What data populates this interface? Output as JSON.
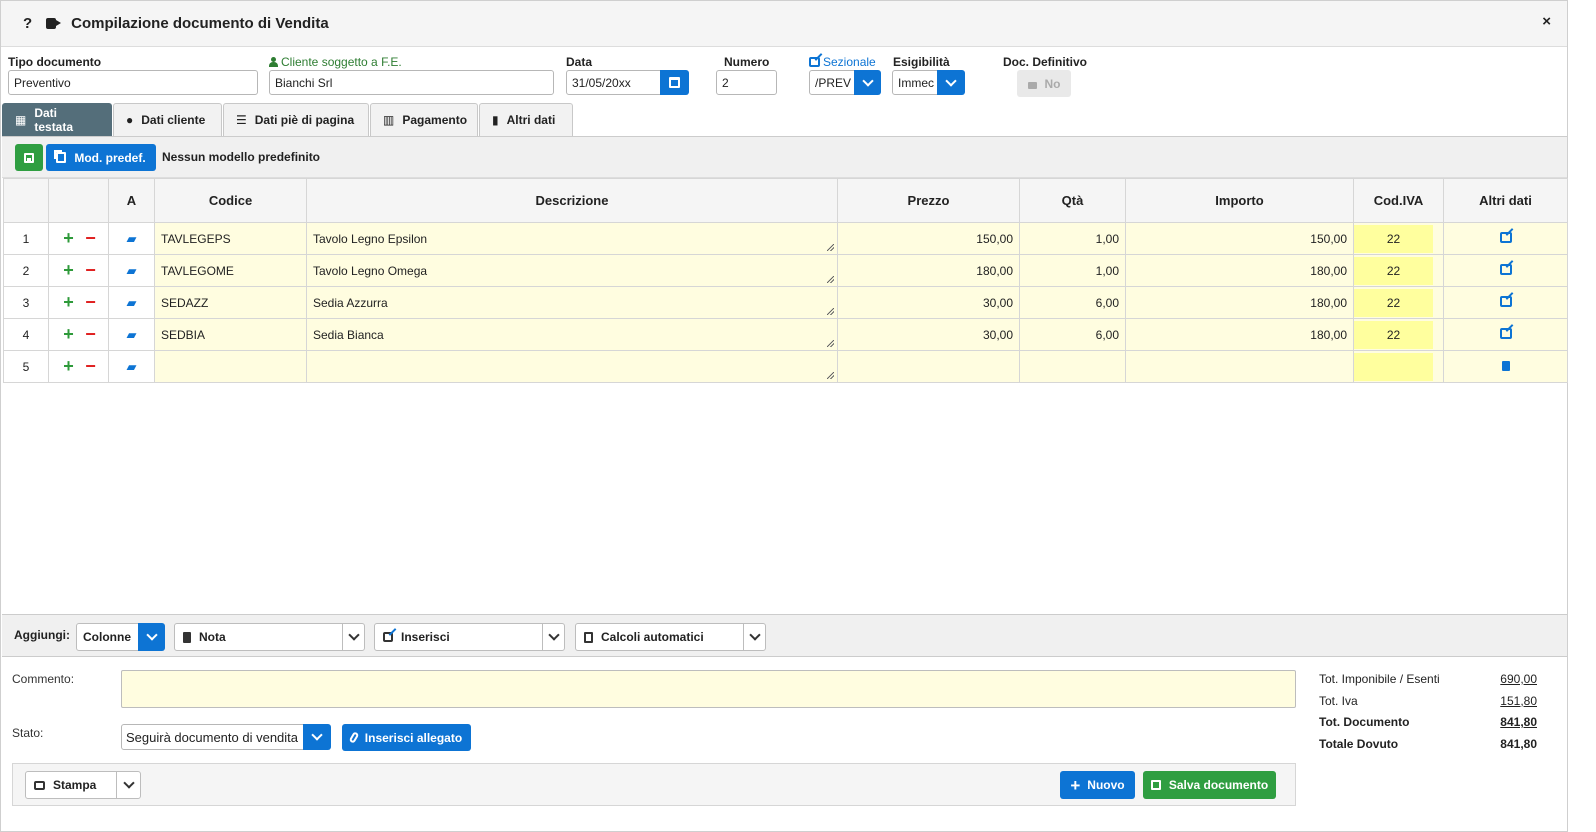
{
  "title": {
    "help": "?",
    "text": "Compilazione documento di Vendita",
    "close": "×"
  },
  "header": {
    "tipo_label": "Tipo documento",
    "tipo_value": "Preventivo",
    "cliente_label": "Cliente soggetto a F.E.",
    "cliente_value": "Bianchi Srl",
    "data_label": "Data",
    "data_value": "31/05/20xx",
    "numero_label": "Numero",
    "numero_value": "2",
    "sezionale_label": "Sezionale",
    "sezionale_value": "/PREV",
    "esigibilita_label": "Esigibilità",
    "esigibilita_value": "Immec",
    "definitivo_label": "Doc. Definitivo",
    "definitivo_value": "No"
  },
  "tabs": [
    {
      "label": "Dati testata",
      "icon": "table-icon"
    },
    {
      "label": "Dati cliente",
      "icon": "user-icon"
    },
    {
      "label": "Dati piè di pagina",
      "icon": "list-icon"
    },
    {
      "label": "Pagamento",
      "icon": "calendar-icon"
    },
    {
      "label": "Altri dati",
      "icon": "file-icon"
    }
  ],
  "toolbar": {
    "mod_label": "Mod. predef.",
    "mod_text": "Nessun modello predefinito"
  },
  "grid": {
    "headers": {
      "a": "A",
      "codice": "Codice",
      "descrizione": "Descrizione",
      "prezzo": "Prezzo",
      "qta": "Qtà",
      "importo": "Importo",
      "iva": "Cod.IVA",
      "altri": "Altri dati"
    },
    "rows": [
      {
        "n": "1",
        "codice": "TAVLEGEPS",
        "descrizione": "Tavolo Legno Epsilon",
        "prezzo": "150,00",
        "qta": "1,00",
        "importo": "150,00",
        "iva": "22"
      },
      {
        "n": "2",
        "codice": "TAVLEGOME",
        "descrizione": "Tavolo Legno Omega",
        "prezzo": "180,00",
        "qta": "1,00",
        "importo": "180,00",
        "iva": "22"
      },
      {
        "n": "3",
        "codice": "SEDAZZ",
        "descrizione": "Sedia Azzurra",
        "prezzo": "30,00",
        "qta": "6,00",
        "importo": "180,00",
        "iva": "22"
      },
      {
        "n": "4",
        "codice": "SEDBIA",
        "descrizione": "Sedia Bianca",
        "prezzo": "30,00",
        "qta": "6,00",
        "importo": "180,00",
        "iva": "22"
      },
      {
        "n": "5",
        "codice": "",
        "descrizione": "",
        "prezzo": "",
        "qta": "",
        "importo": "",
        "iva": ""
      }
    ]
  },
  "bottombar": {
    "aggiungi": "Aggiungi:",
    "colonne": "Colonne",
    "nota": "Nota",
    "inserisci": "Inserisci",
    "calcoli": "Calcoli automatici"
  },
  "comment": {
    "label": "Commento:",
    "value": ""
  },
  "stato": {
    "label": "Stato:",
    "value": "Seguirà documento di vendita",
    "attach": "Inserisci allegato"
  },
  "totals": [
    {
      "label": "Tot. Imponibile / Esenti",
      "value": "690,00",
      "bold": false
    },
    {
      "label": "Tot. Iva",
      "value": "151,80",
      "bold": false
    },
    {
      "label": "Tot. Documento",
      "value": "841,80",
      "bold": true
    },
    {
      "label": "Totale Dovuto",
      "value": "841,80",
      "bold": true
    }
  ],
  "footer": {
    "stampa": "Stampa",
    "nuovo": "Nuovo",
    "salva": "Salva documento"
  },
  "colors": {
    "accent": "#0d74d4",
    "green": "#2f9e41",
    "tab_active": "#546e7a",
    "row_bg": "#fffde0",
    "iva_bg": "#ffff9e"
  }
}
